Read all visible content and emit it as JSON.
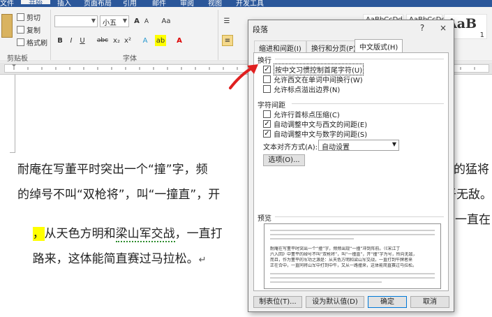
{
  "ribbon": {
    "tabs": [
      "文件",
      "开始",
      "插入",
      "页面布局",
      "引用",
      "邮件",
      "审阅",
      "视图",
      "开发工具"
    ],
    "clipboard": {
      "cut": "剪切",
      "copy": "复制",
      "format_painter": "格式刷",
      "label": "剪贴板"
    },
    "font": {
      "size": "小五",
      "grow": "A",
      "shrink": "A",
      "case": "Aa",
      "bold": "B",
      "italic": "I",
      "underline": "U",
      "strike": "abc",
      "sub": "x₂",
      "sup": "x²",
      "label": "字体"
    },
    "styles": {
      "preview1": "AaBbCcDd",
      "preview2": "AaBbCcDd",
      "preview3": "AaB",
      "number": "1"
    }
  },
  "document": {
    "line1": "耐庵在写董平时突出一个“撞”字，频",
    "line1_right": "的猛将",
    "line2": "的绰号不叫“双枪将”，叫“一撞直”，开",
    "line2_right": "吾无敌。",
    "line3_hl": "，",
    "line3a": "从天色方明和",
    "line3b": "梁山军交战",
    "line3c": "，一直打",
    "line3_right": "一直在",
    "line4": "路来，这体能简直赛过马拉松。",
    "paragraph_mark": "↵"
  },
  "dialog": {
    "title": "段落",
    "help": "?",
    "close": "×",
    "tabs": [
      "缩进和间距(I)",
      "换行和分页(P)",
      "中文版式(H)"
    ],
    "sections": {
      "wrap": "换行",
      "spacing": "字符间距",
      "preview": "预览"
    },
    "wrap_options": [
      {
        "label": "按中文习惯控制首尾字符(U)",
        "checked": true
      },
      {
        "label": "允许西文在单词中间换行(W)",
        "checked": false
      },
      {
        "label": "允许标点溢出边界(N)",
        "checked": false
      }
    ],
    "spacing_options": [
      {
        "label": "允许行首标点压缩(C)",
        "checked": false
      },
      {
        "label": "自动调整中文与西文的间距(E)",
        "checked": true
      },
      {
        "label": "自动调整中文与数字的间距(S)",
        "checked": true
      }
    ],
    "align_label": "文本对齐方式(A):",
    "align_value": "自动设置",
    "options_button": "选项(O)...",
    "preview_text": [
      "耐庵在写董平时突出一个“撞”字，频频出现“一撞”冲到阵前。（《宋江丁",
      "六入回》中董平的绰号不叫“双枪将”，叫“一撞直”，开“撞”字为号，所向无敌，",
      "而且，作为董平的军功之源是：从天色方明和梁山军交战，一直打到午牌者来",
      "正在合中，一直同将山军中打到中午，又从一路撞来，这体能简直赛过马拉松。"
    ],
    "buttons": {
      "tabs": "制表位(T)...",
      "default": "设为默认值(D)",
      "ok": "确定",
      "cancel": "取消"
    }
  },
  "colors": {
    "accent": "#2b579a",
    "arrow": "#e02020",
    "highlight": "#ffff00"
  }
}
